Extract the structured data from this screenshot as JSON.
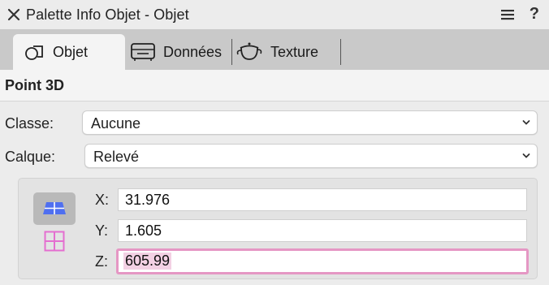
{
  "window": {
    "title": "Palette Info Objet - Objet",
    "close_icon": "close-icon",
    "menu_icon": "hamburger-menu-icon",
    "help_label": "?"
  },
  "tabs": [
    {
      "label": "Objet",
      "icon": "object-icon",
      "active": true
    },
    {
      "label": "Données",
      "icon": "data-icon",
      "active": false
    },
    {
      "label": "Texture",
      "icon": "teapot-texture-icon",
      "active": false
    }
  ],
  "section": {
    "title": "Point 3D"
  },
  "fields": {
    "classe": {
      "label": "Classe:",
      "value": "Aucune"
    },
    "calque": {
      "label": "Calque:",
      "value": "Relevé"
    }
  },
  "coordinates": {
    "x": {
      "label": "X:",
      "value": "31.976"
    },
    "y": {
      "label": "Y:",
      "value": "1.605"
    },
    "z": {
      "label": "Z:",
      "value": "605.99"
    }
  },
  "colors": {
    "accent_blue": "#4f6ff0",
    "accent_pink": "#e46fd0",
    "focus_ring": "#e597c4"
  }
}
